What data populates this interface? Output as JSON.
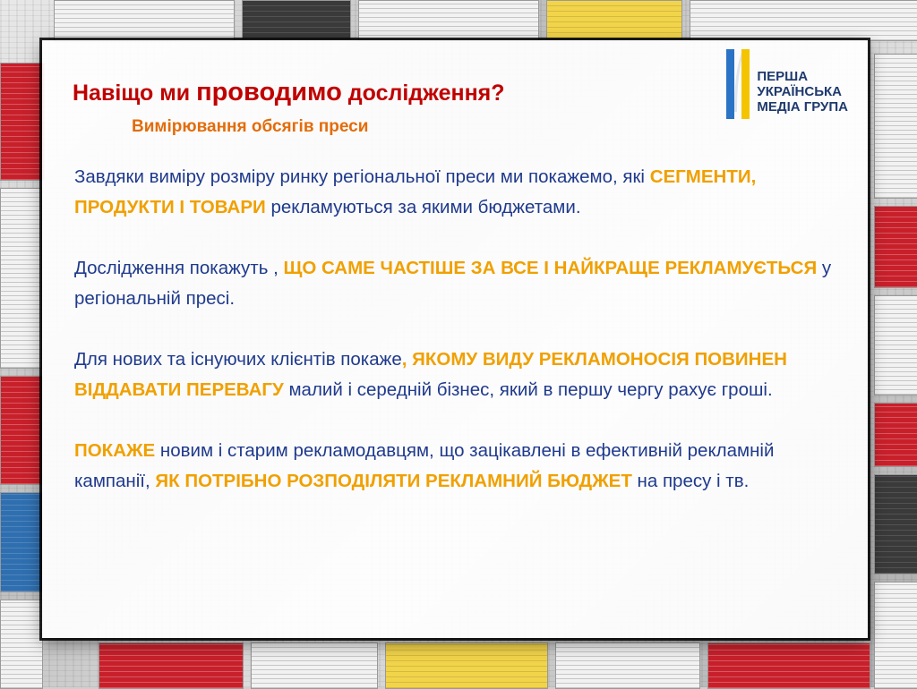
{
  "slide": {
    "title_part1": "Навіщо ми ",
    "title_part2": "проводимо",
    "title_part3": " дослідження?",
    "subtitle": "Вимірювання обсягів преси"
  },
  "logo": {
    "line1": "ПЕРША",
    "line2": "УКРАЇНСЬКА",
    "line3": "МЕДІА ГРУПА",
    "icon": "quill-flag-icon",
    "colors": {
      "blue": "#2a73c5",
      "yellow": "#f5c400",
      "text": "#1f3a6e"
    }
  },
  "paragraphs": {
    "p1": {
      "a": "Завдяки виміру розміру ринку регіональної преси ми покажемо, які ",
      "b": "СЕГМЕНТИ, ПРОДУКТИ І ТОВАРИ",
      "c": " рекламуються за якими бюджетами."
    },
    "p2": {
      "a": "Дослідження покажуть , ",
      "b": "ЩО  САМЕ ЧАСТІШЕ ЗА ВСЕ І НАЙКРАЩЕ РЕКЛАМУЄТЬСЯ",
      "c": " у регіональній пресі."
    },
    "p3": {
      "a": "Для нових та існуючих клієнтів покаже",
      "b": ", ЯКОМУ ВИДУ РЕКЛАМОНОСІЯ ПОВИНЕН ВІДДАВАТИ ПЕРЕВАГУ",
      "c": "  малий і середній бізнес, який в першу чергу рахує гроші."
    },
    "p4": {
      "a": "ПОКАЖЕ",
      "b": " новим і старим рекламодавцям, що зацікавлені в ефективній рекламній кампанії, ",
      "c": "ЯК ПОТРІБНО РОЗПОДІЛЯТИ РЕКЛАМНИЙ БЮДЖЕТ",
      "d": " на пресу і тв."
    }
  },
  "colors": {
    "title": "#c00000",
    "subtitle": "#e36c0a",
    "body": "#1f3a8c",
    "highlight": "#f0a000"
  }
}
